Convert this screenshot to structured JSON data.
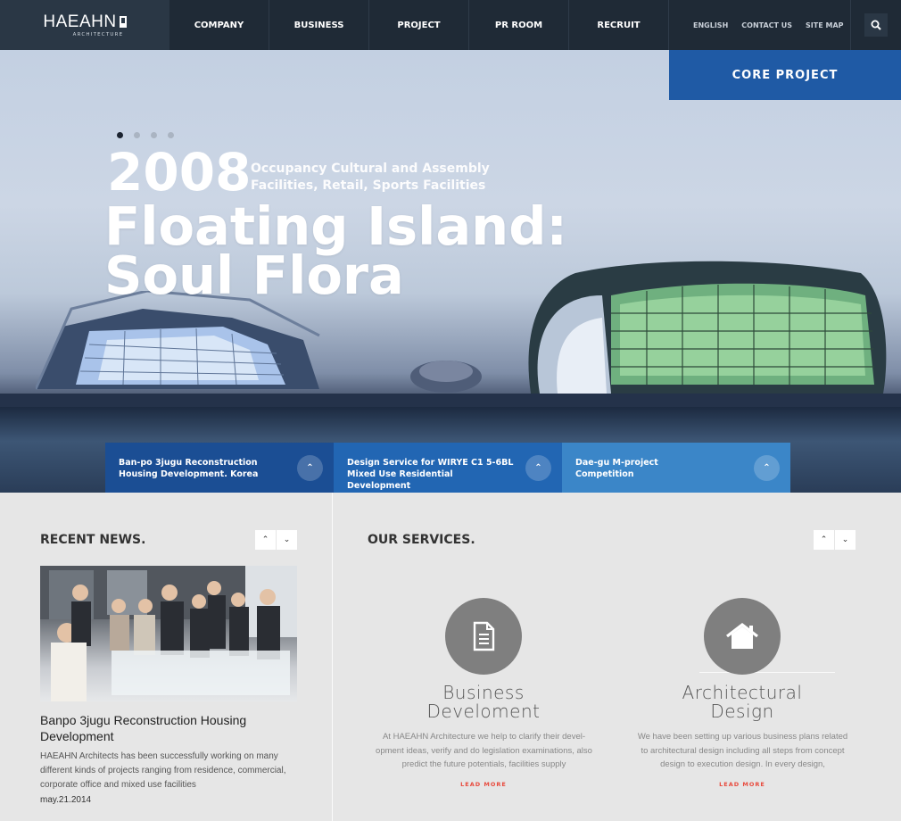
{
  "nav": {
    "logo_text": "HAEAHN",
    "logo_sub": "ARCHITECTURE",
    "menu": [
      "COMPANY",
      "BUSINESS",
      "PROJECT",
      "PR ROOM",
      "RECRUIT"
    ],
    "util": [
      "ENGLISH",
      "CONTACT US",
      "SITE MAP"
    ],
    "search_icon": "search-icon"
  },
  "hero": {
    "core_label": "CORE PROJECT",
    "slides_total": 4,
    "active_slide": 1,
    "year": "2008",
    "category": "Occupancy Cultural and Assembly Facilities, Retail, Sports Facilities",
    "title": "Floating Island: Soul Flora",
    "tabs": [
      {
        "label": "Ban-po 3jugu Reconstruction Housing Development. Korea",
        "icon": "chevron-up-icon"
      },
      {
        "label": "Design Service for WIRYE C1 5-6BL Mixed Use Residential Development",
        "icon": "chevron-up-icon"
      },
      {
        "label": "Dae-gu M-project Competition",
        "icon": "chevron-up-icon"
      }
    ]
  },
  "news": {
    "section_title": "RECENT NEWS.",
    "title": "Banpo 3jugu Reconstruction Housing Development",
    "body": "HAEAHN Architects has been successfully working on many different kinds of projects ranging from residence, commercial, corporate office and mixed use facilities",
    "date": "may.21.2014"
  },
  "services": {
    "section_title": "OUR SERVICES.",
    "items": [
      {
        "icon": "document-icon",
        "name": "Business Develoment",
        "desc": "At HAEAHN Architecture we help to clarify their devel-opment ideas, verify and do legislation examinations, also predict the future potentials, facilities supply",
        "more": "LEAD MORE"
      },
      {
        "icon": "home-icon",
        "name": "Architectural Design",
        "desc": "We have been setting up various business plans related to architectural design including all steps from concept design to execution design. In every design,",
        "more": "LEAD MORE"
      }
    ]
  },
  "colors": {
    "nav_bg": "#1f2a36",
    "accent_blue": "#1f5aa5",
    "tab1": "#1b4e94",
    "tab2": "#2266b3",
    "tab3": "#3b86c8",
    "link_red": "#e84a3d"
  }
}
